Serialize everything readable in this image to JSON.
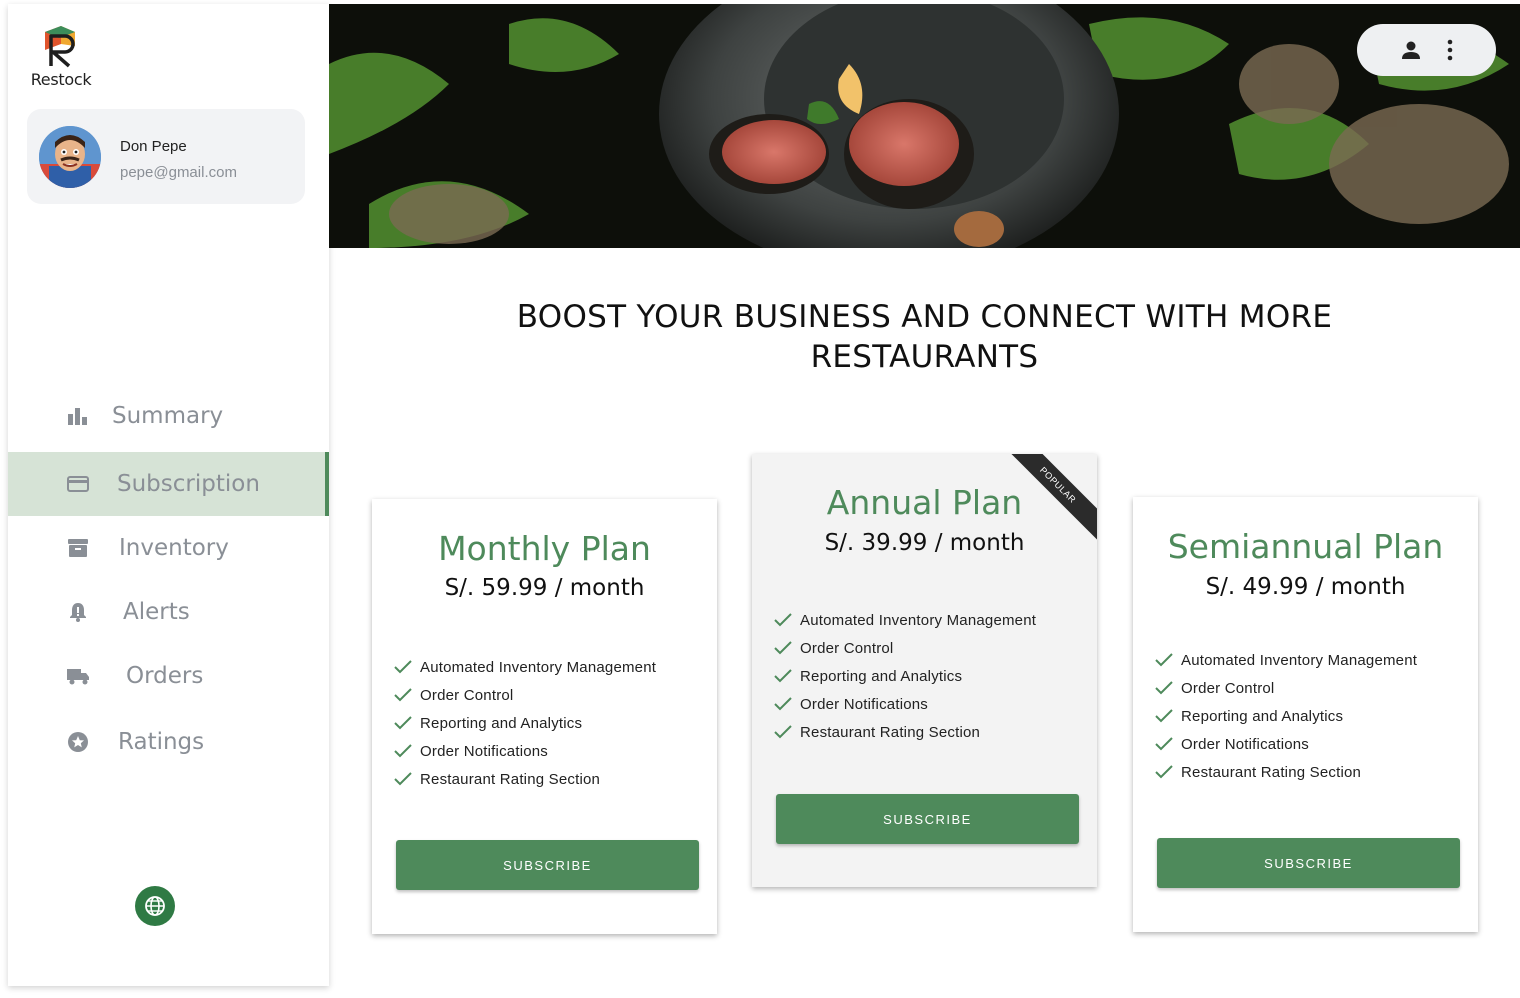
{
  "brand": {
    "name": "Restock"
  },
  "user": {
    "name": "Don Pepe",
    "email": "pepe@gmail.com"
  },
  "nav": {
    "items": [
      {
        "label": "Summary",
        "icon": "bar-chart-icon"
      },
      {
        "label": "Subscription",
        "icon": "credit-card-icon",
        "active": true
      },
      {
        "label": "Inventory",
        "icon": "archive-box-icon"
      },
      {
        "label": "Alerts",
        "icon": "bell-alert-icon"
      },
      {
        "label": "Orders",
        "icon": "truck-icon"
      },
      {
        "label": "Ratings",
        "icon": "star-circle-icon"
      }
    ]
  },
  "header": {
    "icons": [
      "person-icon",
      "more-vertical-icon"
    ]
  },
  "headline": {
    "line1": "BOOST YOUR BUSINESS AND CONNECT WITH MORE",
    "line2": "RESTAURANTS"
  },
  "plans": [
    {
      "name": "Monthly Plan",
      "price": "S/. 59.99 / month",
      "button": "SUBSCRIBE",
      "features": [
        "Automated Inventory Management",
        "Order Control",
        "Reporting and Analytics",
        "Order Notifications",
        "Restaurant Rating Section"
      ]
    },
    {
      "name": "Annual Plan",
      "price": "S/. 39.99 / month",
      "button": "SUBSCRIBE",
      "badge": "POPULAR",
      "features": [
        "Automated Inventory Management",
        "Order Control",
        "Reporting and Analytics",
        "Order Notifications",
        "Restaurant Rating Section"
      ]
    },
    {
      "name": "Semiannual Plan",
      "price": "S/. 49.99 / month",
      "button": "SUBSCRIBE",
      "features": [
        "Automated Inventory Management",
        "Order Control",
        "Reporting and Analytics",
        "Order Notifications",
        "Restaurant Rating Section"
      ]
    }
  ],
  "colors": {
    "accent": "#4e8a5b",
    "active_nav_bg": "#d6e3d6",
    "globe_button": "#2f7a44",
    "muted_text": "#8a8f96"
  }
}
